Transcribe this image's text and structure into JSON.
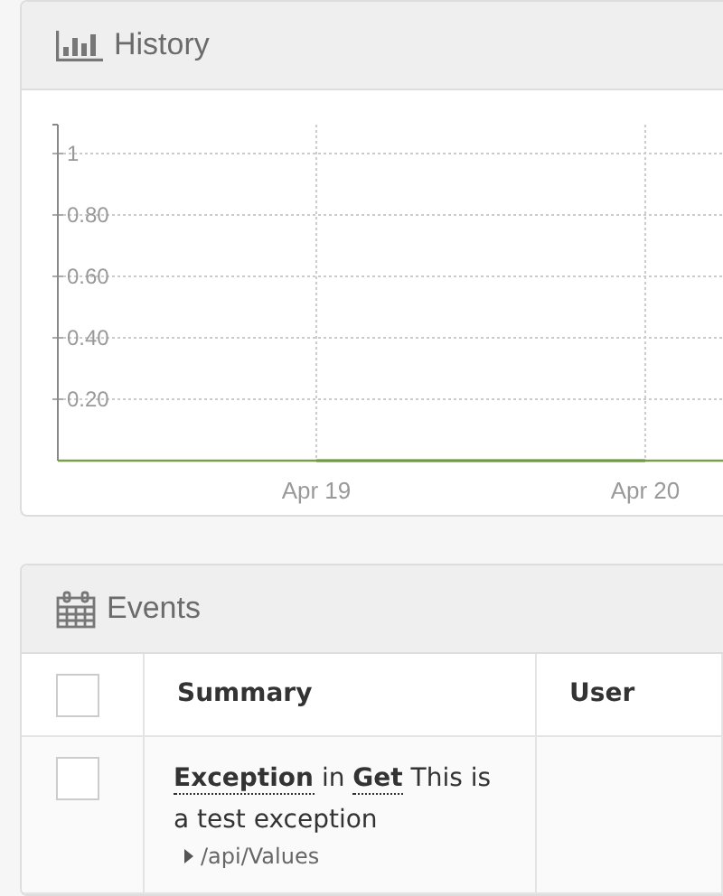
{
  "history": {
    "title": "History",
    "chart_data": {
      "type": "line",
      "categories": [
        "Apr 19",
        "Apr 20"
      ],
      "series": [
        {
          "color": "#6f9a44",
          "values": [
            0,
            0
          ]
        }
      ],
      "grid": true,
      "ylim": [
        0,
        1
      ],
      "yticks": [
        {
          "value": 0.2,
          "label": "0.20"
        },
        {
          "value": 0.4,
          "label": "0.40"
        },
        {
          "value": 0.6,
          "label": "0.60"
        },
        {
          "value": 0.8,
          "label": "0.80"
        },
        {
          "value": 1,
          "label": "1"
        }
      ]
    }
  },
  "events": {
    "title": "Events",
    "columns": [
      {
        "kind": "checkbox",
        "checked": false
      },
      {
        "kind": "text",
        "label": "Summary"
      },
      {
        "kind": "text",
        "label": "User"
      }
    ],
    "rows": [
      {
        "checked": false,
        "summary": "**Exception** in **Get** This is a test exception",
        "path": "/api/Values"
      }
    ]
  }
}
